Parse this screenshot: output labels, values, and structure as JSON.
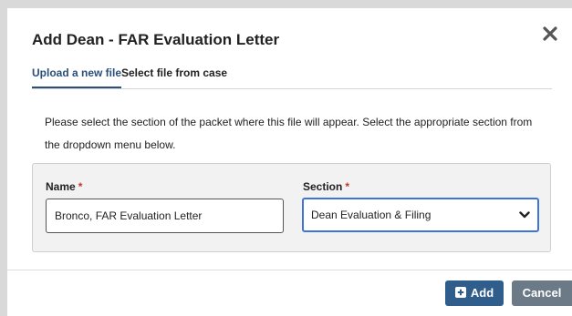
{
  "dialog": {
    "title": "Add Dean - FAR Evaluation Letter",
    "close_icon": "close-icon"
  },
  "tabs": [
    {
      "label": "Upload a new file",
      "active": true
    },
    {
      "label": "Select file from case",
      "active": false
    }
  ],
  "instructions": "Please select the section of the packet where this file will appear. Select the appropriate section from the dropdown menu below.",
  "form": {
    "name_label": "Name",
    "name_required_marker": "*",
    "name_value": "Bronco, FAR Evaluation Letter",
    "section_label": "Section",
    "section_required_marker": "*",
    "section_value": "Dean Evaluation & Filing",
    "section_icon": "chevron-down-icon"
  },
  "footer": {
    "add_label": "Add",
    "add_icon": "plus-square-icon",
    "cancel_label": "Cancel"
  },
  "colors": {
    "accent": "#2a4f7a",
    "add_button": "#2f5e8c",
    "cancel_button": "#6c7a87",
    "focus_border": "#3d74d6",
    "required": "#c0392b"
  }
}
